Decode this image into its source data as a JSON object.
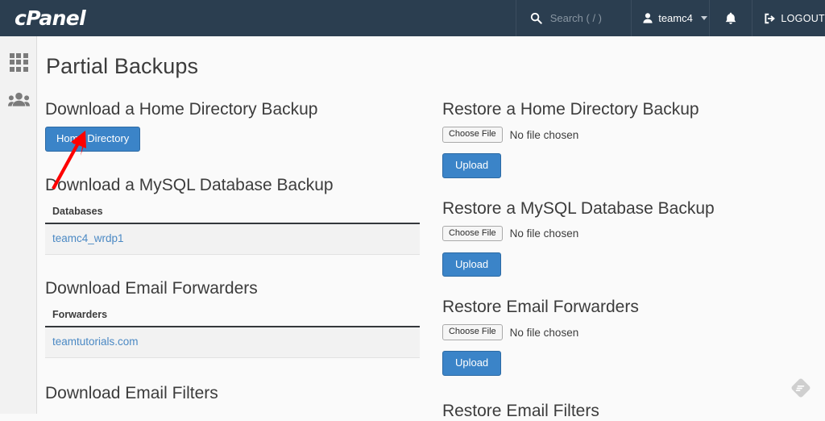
{
  "header": {
    "logo_text": "cPanel",
    "search": {
      "placeholder": "Search ( / )",
      "icon": "search-icon"
    },
    "user": {
      "name": "teamc4",
      "icon": "user-icon",
      "caret": "chevron-down-icon"
    },
    "notifications": {
      "icon": "bell-icon"
    },
    "logout": {
      "label": "LOGOUT",
      "icon": "logout-icon"
    },
    "bg_color": "#2b3e50"
  },
  "sidebar": {
    "items": [
      {
        "name": "apps-grid",
        "icon": "grid-icon"
      },
      {
        "name": "users",
        "icon": "users-icon"
      }
    ],
    "bg_color": "#f2f2f2"
  },
  "main": {
    "page_title": "Partial Backups",
    "left_column": {
      "home_dir": {
        "title": "Download a Home Directory Backup",
        "button_label": "Home Directory"
      },
      "mysql": {
        "title": "Download a MySQL Database Backup",
        "table": {
          "header": "Databases",
          "rows": [
            "teamc4_wrdp1"
          ]
        }
      },
      "forwarders": {
        "title": "Download Email Forwarders",
        "table": {
          "header": "Forwarders",
          "rows": [
            "teamtutorials.com"
          ]
        }
      },
      "filters": {
        "title": "Download Email Filters"
      }
    },
    "right_column": {
      "home_dir": {
        "title": "Restore a Home Directory Backup",
        "choose_file_label": "Choose File",
        "file_status": "No file chosen",
        "upload_label": "Upload"
      },
      "mysql": {
        "title": "Restore a MySQL Database Backup",
        "choose_file_label": "Choose File",
        "file_status": "No file chosen",
        "upload_label": "Upload"
      },
      "forwarders": {
        "title": "Restore Email Forwarders",
        "choose_file_label": "Choose File",
        "file_status": "No file chosen",
        "upload_label": "Upload"
      },
      "filters": {
        "title": "Restore Email Filters"
      }
    }
  },
  "annotation": {
    "arrow_color": "#fe0000",
    "points_to": "Home Directory"
  },
  "corner_badge": {
    "icon": "feed-badge-icon",
    "color": "#cfcfcf"
  },
  "colors": {
    "accent_blue": "#3b84c8",
    "link_blue": "#4b89c4",
    "header_bg": "#2b3e50",
    "page_bg": "#fafafa",
    "row_bg": "#f2f2f2"
  }
}
